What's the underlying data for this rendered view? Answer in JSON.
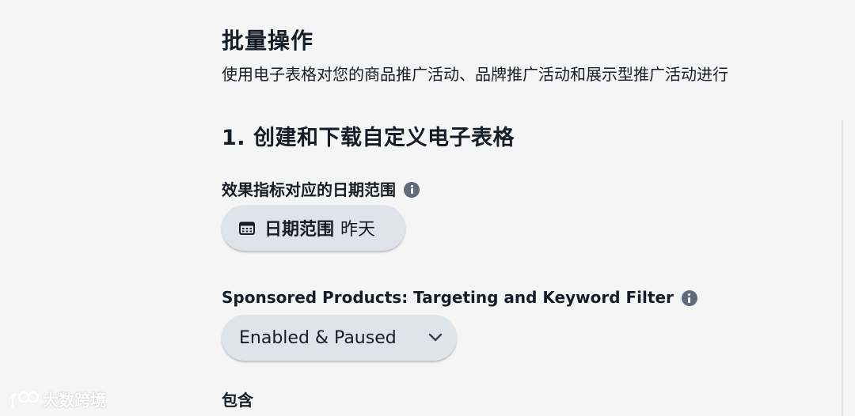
{
  "header": {
    "title": "批量操作",
    "description": "使用电子表格对您的商品推广活动、品牌推广活动和展示型推广活动进行"
  },
  "section": {
    "title": "1. 创建和下载自定义电子表格"
  },
  "date_field": {
    "label": "效果指标对应的日期范围",
    "button_label": "日期范围",
    "button_value": "昨天"
  },
  "filter_field": {
    "label": "Sponsored Products: Targeting and Keyword Filter",
    "selected": "Enabled & Paused"
  },
  "include_field": {
    "label": "包含"
  },
  "watermark": {
    "text": "大数跨境"
  },
  "icons": [
    "info-icon",
    "calendar-icon",
    "chevron-down-icon",
    "watermark-logo-icon"
  ],
  "colors": {
    "text": "#161d26",
    "pill_bg": "#dfe3ea",
    "info_icon": "#5f6b7a",
    "background": "#f5f5f5"
  }
}
